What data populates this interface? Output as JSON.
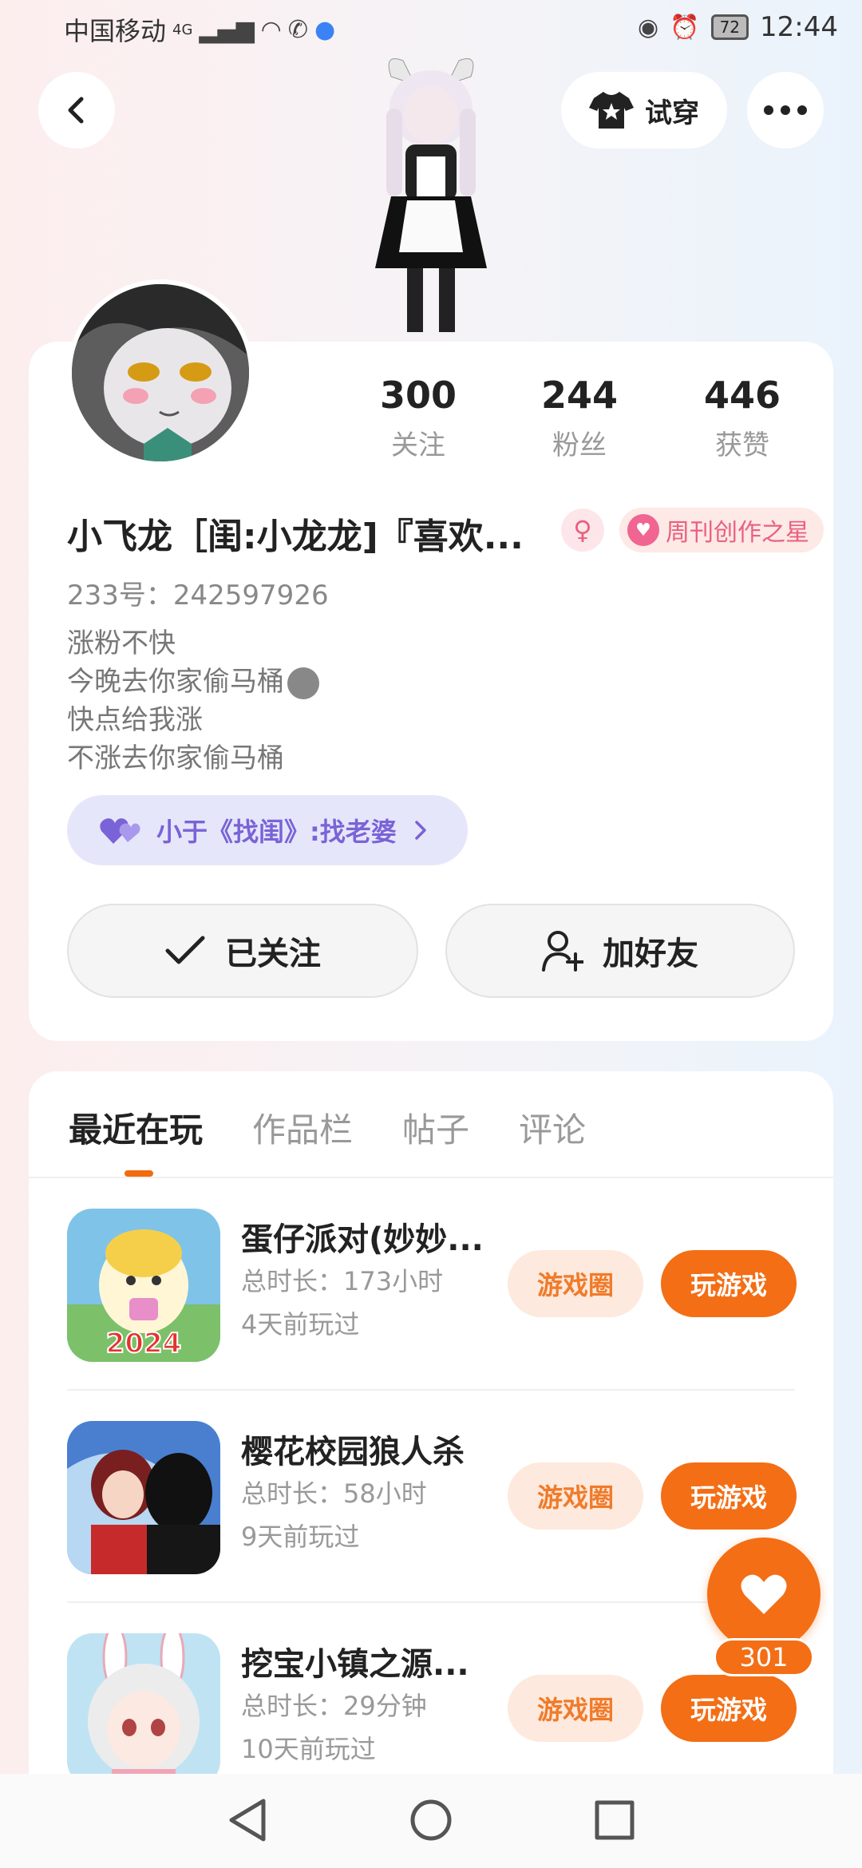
{
  "status_bar": {
    "carrier": "中国移动",
    "network": "4G",
    "time": "12:44",
    "battery": "72"
  },
  "top_actions": {
    "try_on_label": "试穿"
  },
  "profile": {
    "stats": [
      {
        "value": "300",
        "label": "关注"
      },
      {
        "value": "244",
        "label": "粉丝"
      },
      {
        "value": "446",
        "label": "获赞"
      }
    ],
    "username": "小飞龙［闺:小龙龙]『喜欢...",
    "badge_label": "周刊创作之星",
    "user_id": "233号：242597926",
    "bio": [
      "涨粉不快",
      "今晚去你家偷马桶",
      "快点给我涨",
      "不涨去你家偷马桶"
    ],
    "relation_chip": "小于《找闺》:找老婆",
    "follow_label": "已关注",
    "add_friend_label": "加好友"
  },
  "tabs": [
    {
      "label": "最近在玩",
      "active": true
    },
    {
      "label": "作品栏",
      "active": false
    },
    {
      "label": "帖子",
      "active": false
    },
    {
      "label": "评论",
      "active": false
    }
  ],
  "games": [
    {
      "title": "蛋仔派对(妙妙...",
      "duration": "总时长：173小时",
      "last_played": "4天前玩过",
      "icon_text": "2024"
    },
    {
      "title": "樱花校园狼人杀",
      "duration": "总时长：58小时",
      "last_played": "9天前玩过"
    },
    {
      "title": "挖宝小镇之源...",
      "duration": "总时长：29分钟",
      "last_played": "10天前玩过"
    }
  ],
  "game_buttons": {
    "circle_label": "游戏圈",
    "play_label": "玩游戏"
  },
  "like": {
    "count": "301"
  },
  "colors": {
    "accent_orange": "#f36e15",
    "chip_purple": "#7a63d6",
    "badge_pink": "#e9607f"
  }
}
